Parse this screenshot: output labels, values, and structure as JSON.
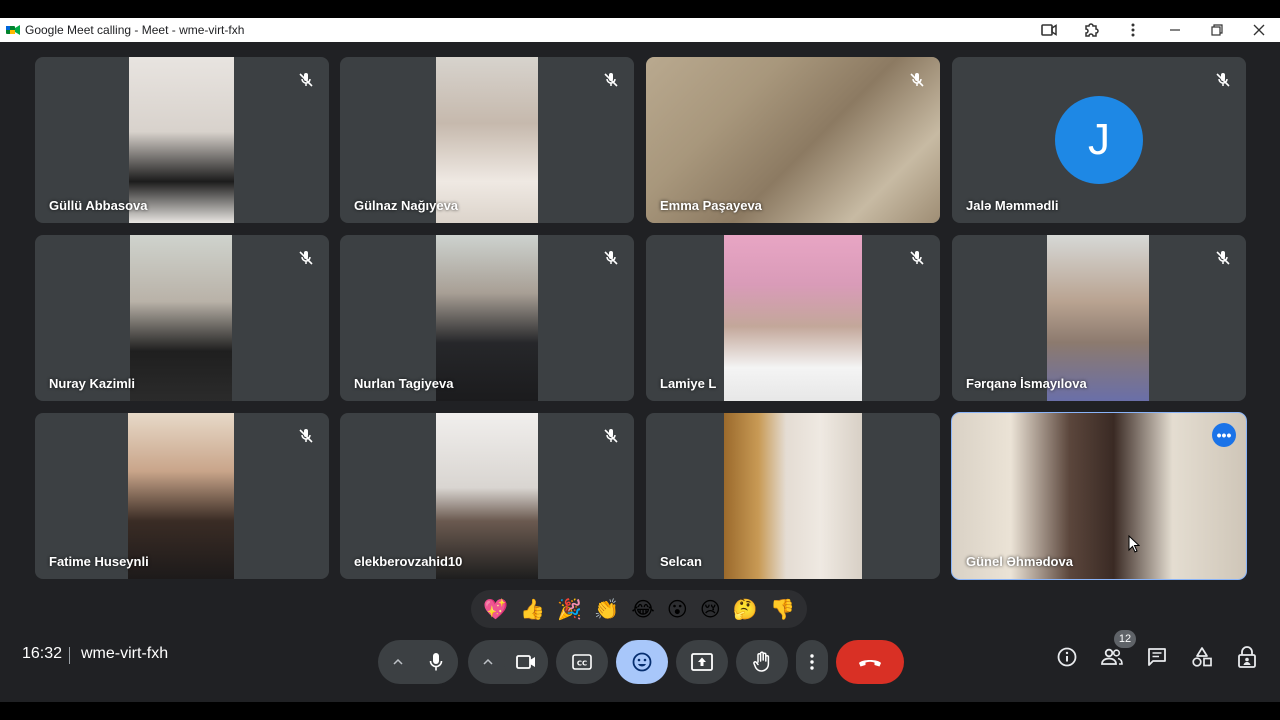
{
  "window": {
    "title": "Google Meet calling - Meet - wme-virt-fxh"
  },
  "participants": [
    {
      "name": "Güllü Abbasova",
      "muted": true
    },
    {
      "name": "Gülnaz Nağıyeva",
      "muted": true
    },
    {
      "name": "Emma Paşayeva",
      "muted": true
    },
    {
      "name": "Jalə Məmmədli",
      "muted": true,
      "avatar_letter": "J",
      "avatar_color": "#1e88e5"
    },
    {
      "name": "Nuray Kazimli",
      "muted": true
    },
    {
      "name": "Nurlan Tagiyeva",
      "muted": true
    },
    {
      "name": "Lamiye L",
      "muted": true
    },
    {
      "name": "Fərqanə İsmayılova",
      "muted": true
    },
    {
      "name": "Fatime Huseynli",
      "muted": true
    },
    {
      "name": "elekberovzahid10",
      "muted": true
    },
    {
      "name": "Selcan",
      "muted": false
    },
    {
      "name": "Günel Əhmədova",
      "muted": false,
      "active_speaker": true
    }
  ],
  "reactions": [
    "💖",
    "👍",
    "🎉",
    "👏",
    "😂",
    "😮",
    "😢",
    "🤔",
    "👎"
  ],
  "meeting": {
    "time": "16:32",
    "code": "wme-virt-fxh"
  },
  "controls": {
    "participants_count": "12"
  },
  "colors": {
    "background": "#202124",
    "tile": "#3c4043",
    "end_call": "#d93025",
    "reactions_active": "#a8c7fa",
    "active_outline": "#8ab4f8"
  }
}
